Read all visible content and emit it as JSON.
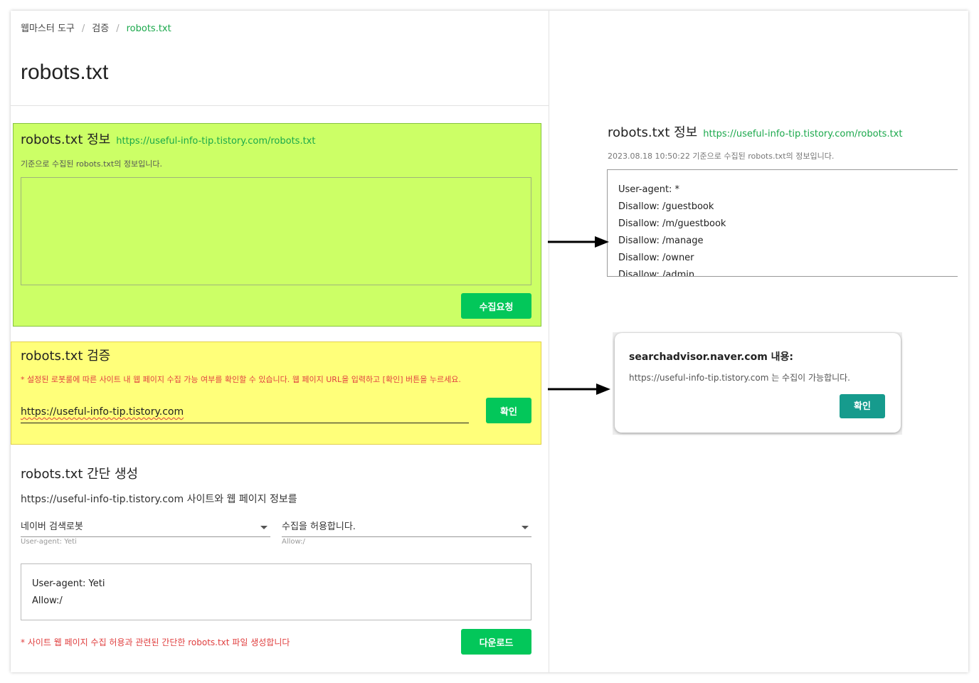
{
  "breadcrumb": [
    "웹마스터 도구",
    "검증",
    "robots.txt"
  ],
  "page_title": "robots.txt",
  "info_section": {
    "title": "robots.txt 정보",
    "link": "https://useful-info-tip.tistory.com/robots.txt",
    "desc": "기준으로 수집된 robots.txt의 정보입니다.",
    "button": "수집요청"
  },
  "verify_section": {
    "title": "robots.txt 검증",
    "warning": "* 설정된 로봇룰에 따른 사이트 내 웹 페이지 수집 가능 여부를 확인할 수 있습니다. 웹 페이지 URL을 입력하고 [확인] 버튼을 누르세요.",
    "url_value": "https://useful-info-tip.tistory.com",
    "button": "확인"
  },
  "generator": {
    "title": "robots.txt 간단 생성",
    "subtitle": "https://useful-info-tip.tistory.com 사이트와 웹 페이지 정보를",
    "robot_select": "네이버 검색로봇",
    "robot_hint": "User-agent: Yeti",
    "allow_select": "수집을 허용합니다.",
    "allow_hint": "Allow:/",
    "lines": [
      "User-agent: Yeti",
      "Allow:/"
    ],
    "note": "* 사이트 웹 페이지 수집 허용과 관련된 간단한 robots.txt 파일 생성합니다",
    "button": "다운로드"
  },
  "right_info": {
    "title": "robots.txt 정보",
    "link": "https://useful-info-tip.tistory.com/robots.txt",
    "desc": "2023.08.18 10:50:22 기준으로 수집된 robots.txt의 정보입니다.",
    "lines": [
      "User-agent: *",
      "Disallow: /guestbook",
      "Disallow: /m/guestbook",
      "Disallow: /manage",
      "Disallow: /owner",
      "Disallow: /admin"
    ]
  },
  "dialog": {
    "title": "searchadvisor.naver.com 내용:",
    "message": "https://useful-info-tip.tistory.com 는 수집이 가능합니다.",
    "button": "확인"
  },
  "colors": {
    "accent_green": "#03c75a",
    "highlight_green": "#ccff66",
    "highlight_yellow": "#ffff7a",
    "warning_red": "#e04040",
    "dialog_teal": "#169b8d"
  }
}
